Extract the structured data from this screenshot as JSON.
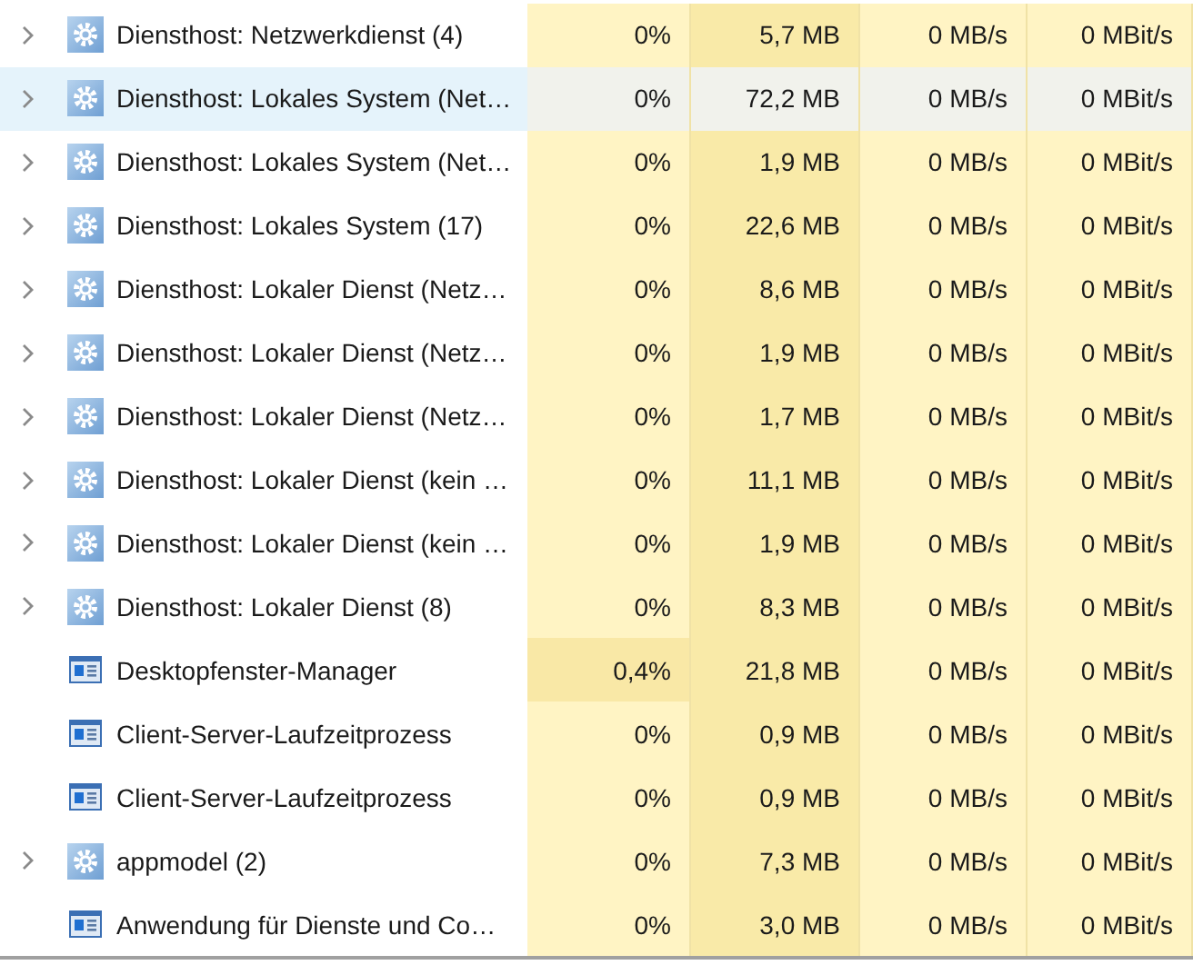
{
  "rows": [
    {
      "kind": "service",
      "expandable": true,
      "selected": false,
      "cpu_high": false,
      "name": "Diensthost: Netzwerkdienst (4)",
      "cpu": "0%",
      "memory": "5,7 MB",
      "disk": "0 MB/s",
      "network": "0 MBit/s"
    },
    {
      "kind": "service",
      "expandable": true,
      "selected": true,
      "cpu_high": false,
      "name": "Diensthost: Lokales System (Net…",
      "cpu": "0%",
      "memory": "72,2 MB",
      "disk": "0 MB/s",
      "network": "0 MBit/s"
    },
    {
      "kind": "service",
      "expandable": true,
      "selected": false,
      "cpu_high": false,
      "name": "Diensthost: Lokales System (Net…",
      "cpu": "0%",
      "memory": "1,9 MB",
      "disk": "0 MB/s",
      "network": "0 MBit/s"
    },
    {
      "kind": "service",
      "expandable": true,
      "selected": false,
      "cpu_high": false,
      "name": "Diensthost: Lokales System (17)",
      "cpu": "0%",
      "memory": "22,6 MB",
      "disk": "0 MB/s",
      "network": "0 MBit/s"
    },
    {
      "kind": "service",
      "expandable": true,
      "selected": false,
      "cpu_high": false,
      "name": "Diensthost: Lokaler Dienst (Netz…",
      "cpu": "0%",
      "memory": "8,6 MB",
      "disk": "0 MB/s",
      "network": "0 MBit/s"
    },
    {
      "kind": "service",
      "expandable": true,
      "selected": false,
      "cpu_high": false,
      "name": "Diensthost: Lokaler Dienst (Netz…",
      "cpu": "0%",
      "memory": "1,9 MB",
      "disk": "0 MB/s",
      "network": "0 MBit/s"
    },
    {
      "kind": "service",
      "expandable": true,
      "selected": false,
      "cpu_high": false,
      "name": "Diensthost: Lokaler Dienst (Netz…",
      "cpu": "0%",
      "memory": "1,7 MB",
      "disk": "0 MB/s",
      "network": "0 MBit/s"
    },
    {
      "kind": "service",
      "expandable": true,
      "selected": false,
      "cpu_high": false,
      "name": "Diensthost: Lokaler Dienst (kein …",
      "cpu": "0%",
      "memory": "11,1 MB",
      "disk": "0 MB/s",
      "network": "0 MBit/s"
    },
    {
      "kind": "service",
      "expandable": true,
      "selected": false,
      "cpu_high": false,
      "name": "Diensthost: Lokaler Dienst (kein …",
      "cpu": "0%",
      "memory": "1,9 MB",
      "disk": "0 MB/s",
      "network": "0 MBit/s"
    },
    {
      "kind": "service",
      "expandable": true,
      "selected": false,
      "cpu_high": false,
      "name": "Diensthost: Lokaler Dienst (8)",
      "cpu": "0%",
      "memory": "8,3 MB",
      "disk": "0 MB/s",
      "network": "0 MBit/s"
    },
    {
      "kind": "app",
      "expandable": false,
      "selected": false,
      "cpu_high": true,
      "name": "Desktopfenster-Manager",
      "cpu": "0,4%",
      "memory": "21,8 MB",
      "disk": "0 MB/s",
      "network": "0 MBit/s"
    },
    {
      "kind": "app",
      "expandable": false,
      "selected": false,
      "cpu_high": false,
      "name": "Client-Server-Laufzeitprozess",
      "cpu": "0%",
      "memory": "0,9 MB",
      "disk": "0 MB/s",
      "network": "0 MBit/s"
    },
    {
      "kind": "app",
      "expandable": false,
      "selected": false,
      "cpu_high": false,
      "name": "Client-Server-Laufzeitprozess",
      "cpu": "0%",
      "memory": "0,9 MB",
      "disk": "0 MB/s",
      "network": "0 MBit/s"
    },
    {
      "kind": "service",
      "expandable": true,
      "selected": false,
      "cpu_high": false,
      "name": "appmodel (2)",
      "cpu": "0%",
      "memory": "7,3 MB",
      "disk": "0 MB/s",
      "network": "0 MBit/s"
    },
    {
      "kind": "app",
      "expandable": false,
      "selected": false,
      "cpu_high": false,
      "name": "Anwendung für Dienste und Co…",
      "cpu": "0%",
      "memory": "3,0 MB",
      "disk": "0 MB/s",
      "network": "0 MBit/s"
    }
  ]
}
